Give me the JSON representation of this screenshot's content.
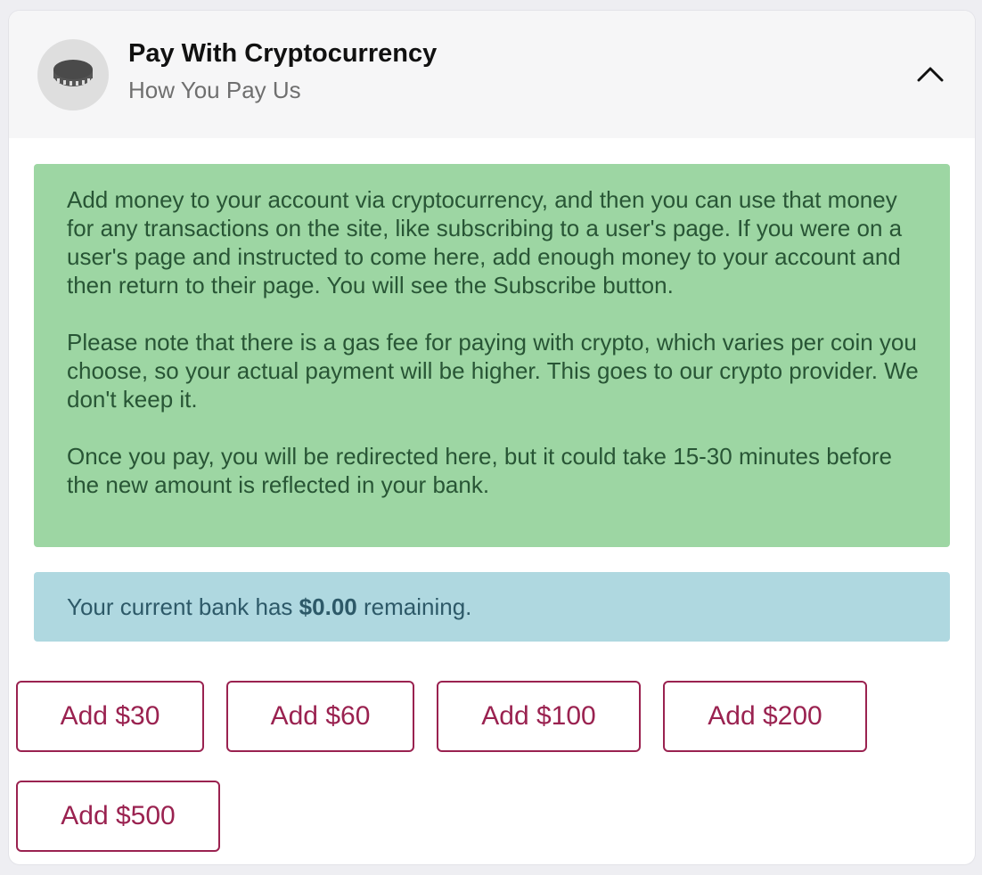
{
  "header": {
    "title": "Pay With Cryptocurrency",
    "subtitle": "How You Pay Us",
    "avatar_icon": "coin-icon",
    "toggle_icon": "chevron-up-icon"
  },
  "info": {
    "paragraphs": [
      "Add money to your account via cryptocurrency, and then you can use that money for any transactions on the site, like subscribing to a user's page. If you were on a user's page and instructed to come here, add enough money to your account and then return to their page. You will see the Subscribe button.",
      "Please note that there is a gas fee for paying with crypto, which varies per coin you choose, so your actual payment will be higher. This goes to our crypto provider. We don't keep it.",
      "Once you pay, you will be redirected here, but it could take 15-30 minutes before the new amount is reflected in your bank."
    ]
  },
  "bank": {
    "prefix": "Your current bank has",
    "amount": "$0.00",
    "suffix": "remaining."
  },
  "add_buttons": [
    {
      "label": "Add $30"
    },
    {
      "label": "Add $60"
    },
    {
      "label": "Add $100"
    },
    {
      "label": "Add $200"
    },
    {
      "label": "Add $500"
    }
  ],
  "colors": {
    "accent": "#9a2250",
    "info_bg": "#9dd6a3",
    "info_text": "#285535",
    "bank_bg": "#afd8e0",
    "bank_text": "#2d5968"
  }
}
